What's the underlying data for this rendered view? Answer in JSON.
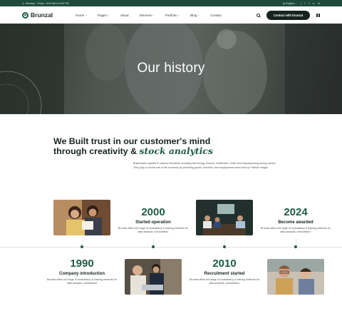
{
  "topbar": {
    "hours": "Monday - Friday : 8:00 AM to 6:00 PM",
    "language": "English",
    "social": [
      "f",
      "t",
      "▸",
      "in"
    ]
  },
  "header": {
    "logo": "Brunzal",
    "nav": [
      "Home",
      "Pages",
      "About",
      "Services",
      "Portfolio",
      "Blog",
      "Contact"
    ],
    "cta": "Contact with brunzal"
  },
  "hero": {
    "title": "Our history"
  },
  "intro": {
    "heading_line1": "We Built trust in our customer's mind",
    "heading_line2_plain": "through creativity & ",
    "heading_line2_em": "stock analytics",
    "paragraph": "Businesses operate in various industries including technology, finance, healthcare, retail, and manufacturing among others. They play a crucial role in the economy by providing goods, services, and employment never fruit up Pasture imagin."
  },
  "timeline": [
    {
      "year": "2000",
      "title": "Started operation",
      "desc": "Brunzal offers full range of consultancy & training methods for data analysis, consultation."
    },
    {
      "year": "2024",
      "title": "Become awarded",
      "desc": "Brunzal offers full range of consultancy & training methods for data analysis, consultation."
    },
    {
      "year": "1990",
      "title": "Company introduction",
      "desc": "Brunzal offers full range of consultancy & training methods for data analysis, consultance"
    },
    {
      "year": "2010",
      "title": "Recruitment started",
      "desc": "Brunzal offers full range of consultancy & training methods for data analysis, consultation."
    }
  ],
  "colors": {
    "brand": "#1e5b46",
    "topbar": "#1e4a3c",
    "dark": "#16231e"
  }
}
